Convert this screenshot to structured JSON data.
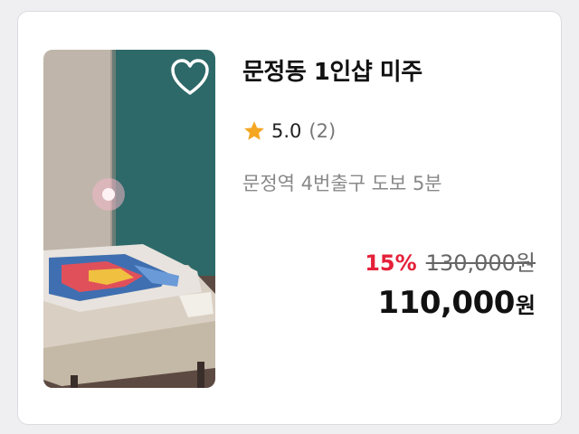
{
  "listing": {
    "title": "문정동 1인샵 미주",
    "rating": "5.0",
    "review_count": "(2)",
    "location": "문정역 4번출구 도보 5분",
    "discount": "15%",
    "original_price": "130,000원",
    "final_price": "110,000",
    "final_unit": "원"
  },
  "icons": {
    "favorite": "heart-outline-icon",
    "rating": "star-icon"
  },
  "colors": {
    "discount": "#e5213a",
    "star": "#f5a623",
    "title": "#111111",
    "muted": "#888888"
  }
}
